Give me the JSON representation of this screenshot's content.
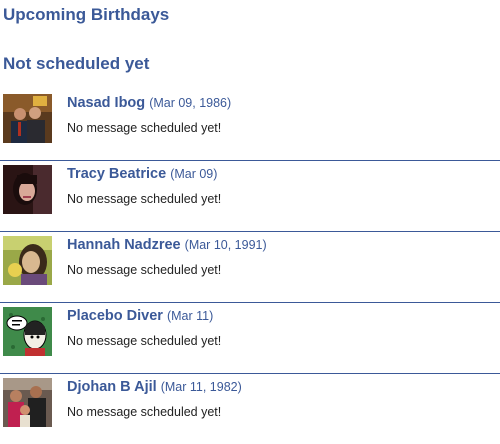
{
  "headings": {
    "upcoming": "Upcoming Birthdays",
    "not_scheduled": "Not scheduled yet"
  },
  "people": [
    {
      "name": "Nasad Ibog",
      "date": "(Mar 09, 1986)",
      "status": "No message scheduled yet!",
      "avatar": "avatar-photo-two-men"
    },
    {
      "name": "Tracy Beatrice",
      "date": "(Mar 09)",
      "status": "No message scheduled yet!",
      "avatar": "avatar-photo-woman-dark"
    },
    {
      "name": "Hannah Nadzree",
      "date": "(Mar 10, 1991)",
      "status": "No message scheduled yet!",
      "avatar": "avatar-photo-woman-green"
    },
    {
      "name": "Placebo Diver",
      "date": "(Mar 11)",
      "status": "No message scheduled yet!",
      "avatar": "avatar-comic-illustration"
    },
    {
      "name": "Djohan B Ajil",
      "date": "(Mar 11, 1982)",
      "status": "No message scheduled yet!",
      "avatar": "avatar-photo-family"
    }
  ],
  "colors": {
    "link": "#3b5998",
    "text": "#222222",
    "divider": "#3b5998"
  }
}
